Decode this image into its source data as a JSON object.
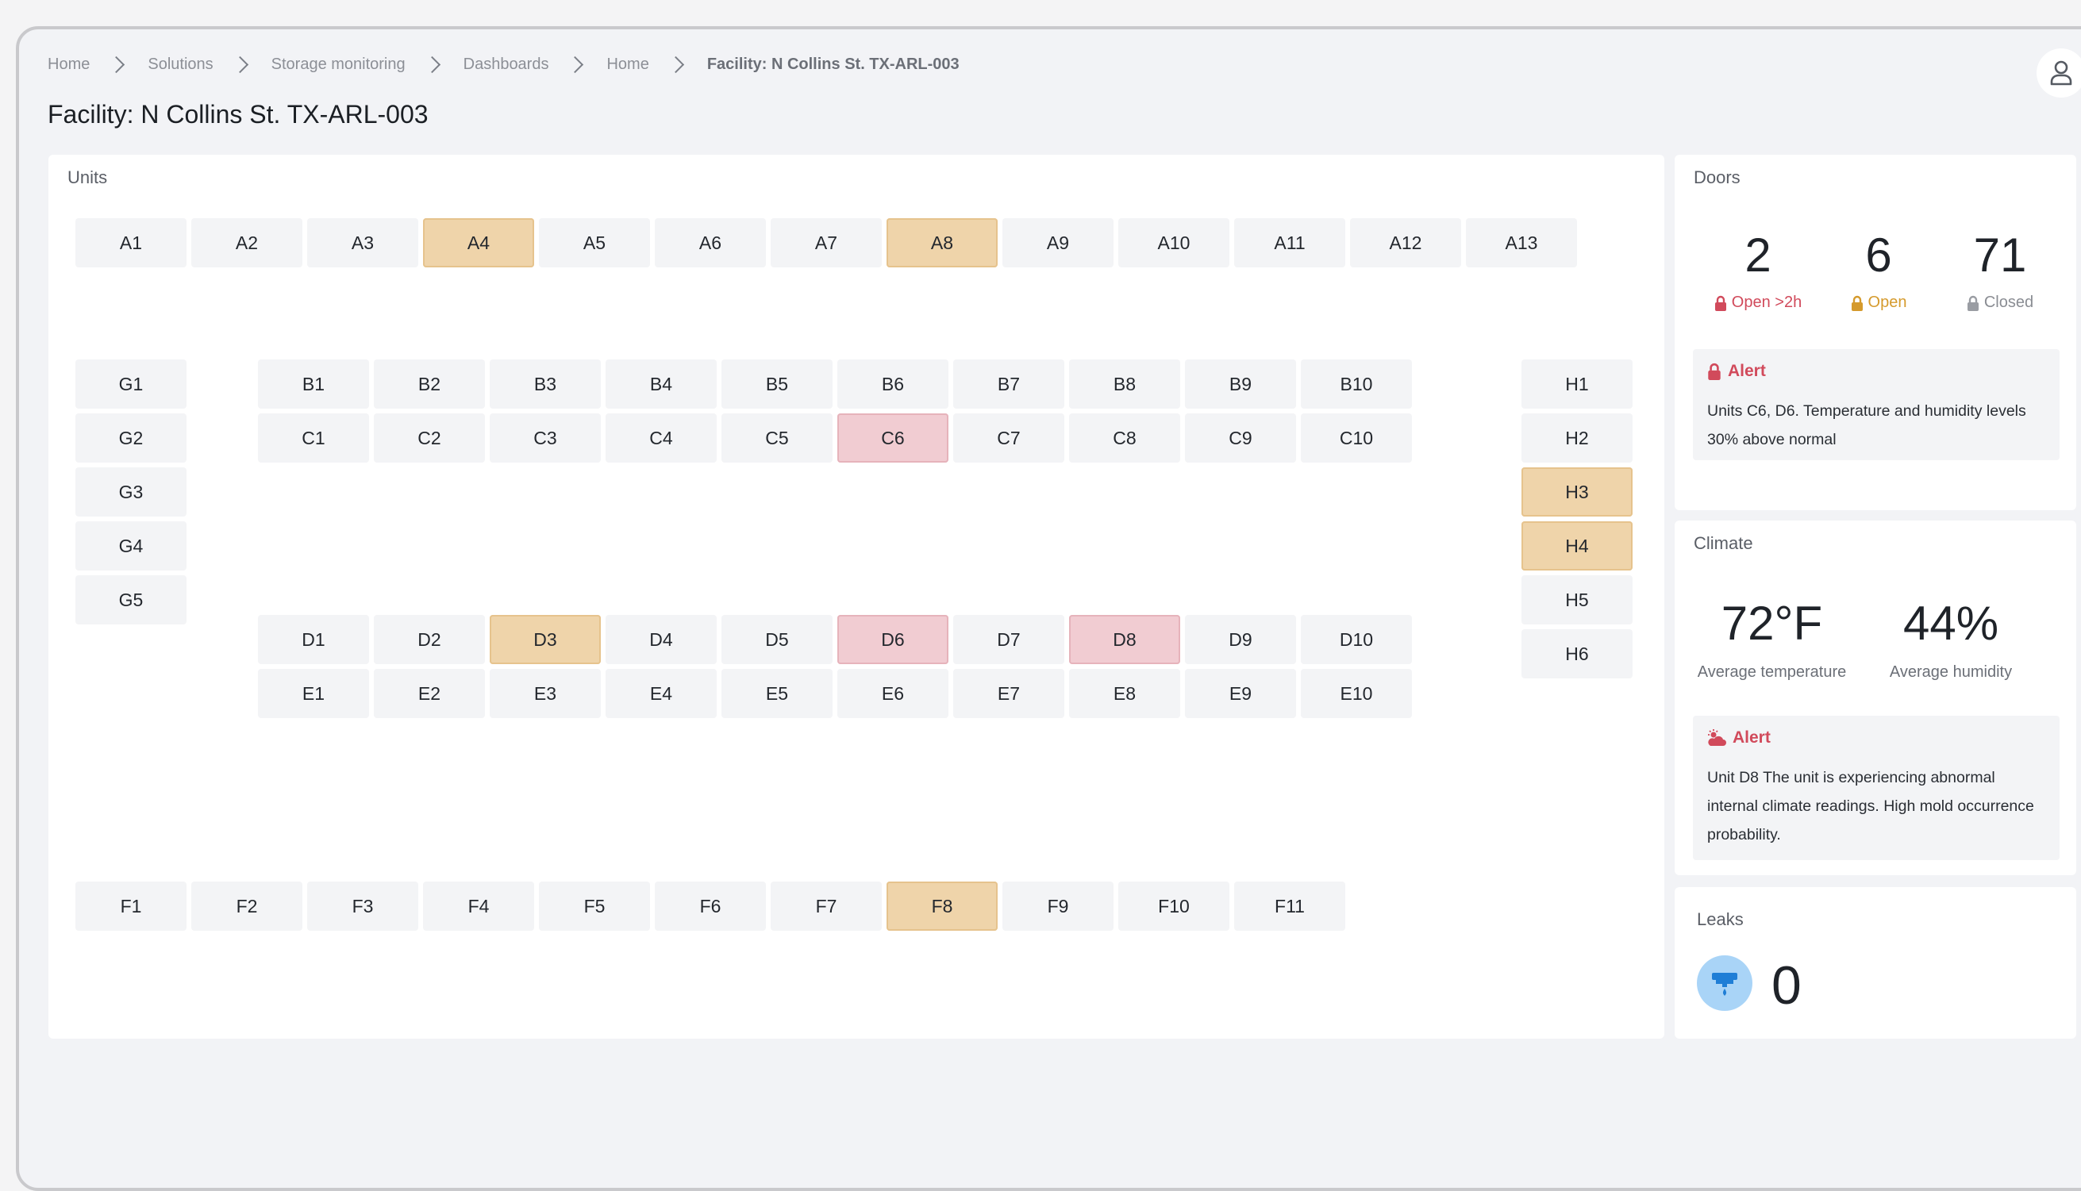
{
  "breadcrumb": [
    "Home",
    "Solutions",
    "Storage monitoring",
    "Dashboards",
    "Home",
    "Facility: N Collins St. TX-ARL-003"
  ],
  "page_title": "Facility: N Collins St. TX-ARL-003",
  "units_panel": {
    "title": "Units",
    "status_colors": {
      "normal": "#f3f4f6",
      "warning": "#efd4aa",
      "danger": "#f1ccd2"
    },
    "rows": [
      {
        "row": "A",
        "units": [
          {
            "id": "A1",
            "status": "normal"
          },
          {
            "id": "A2",
            "status": "normal"
          },
          {
            "id": "A3",
            "status": "normal"
          },
          {
            "id": "A4",
            "status": "warning"
          },
          {
            "id": "A5",
            "status": "normal"
          },
          {
            "id": "A6",
            "status": "normal"
          },
          {
            "id": "A7",
            "status": "normal"
          },
          {
            "id": "A8",
            "status": "warning"
          },
          {
            "id": "A9",
            "status": "normal"
          },
          {
            "id": "A10",
            "status": "normal"
          },
          {
            "id": "A11",
            "status": "normal"
          },
          {
            "id": "A12",
            "status": "normal"
          },
          {
            "id": "A13",
            "status": "normal"
          }
        ]
      },
      {
        "row": "G",
        "units": [
          {
            "id": "G1",
            "status": "normal"
          },
          {
            "id": "G2",
            "status": "normal"
          },
          {
            "id": "G3",
            "status": "normal"
          },
          {
            "id": "G4",
            "status": "normal"
          },
          {
            "id": "G5",
            "status": "normal"
          }
        ]
      },
      {
        "row": "B",
        "units": [
          {
            "id": "B1",
            "status": "normal"
          },
          {
            "id": "B2",
            "status": "normal"
          },
          {
            "id": "B3",
            "status": "normal"
          },
          {
            "id": "B4",
            "status": "normal"
          },
          {
            "id": "B5",
            "status": "normal"
          },
          {
            "id": "B6",
            "status": "normal"
          },
          {
            "id": "B7",
            "status": "normal"
          },
          {
            "id": "B8",
            "status": "normal"
          },
          {
            "id": "B9",
            "status": "normal"
          },
          {
            "id": "B10",
            "status": "normal"
          }
        ]
      },
      {
        "row": "C",
        "units": [
          {
            "id": "C1",
            "status": "normal"
          },
          {
            "id": "C2",
            "status": "normal"
          },
          {
            "id": "C3",
            "status": "normal"
          },
          {
            "id": "C4",
            "status": "normal"
          },
          {
            "id": "C5",
            "status": "normal"
          },
          {
            "id": "C6",
            "status": "danger"
          },
          {
            "id": "C7",
            "status": "normal"
          },
          {
            "id": "C8",
            "status": "normal"
          },
          {
            "id": "C9",
            "status": "normal"
          },
          {
            "id": "C10",
            "status": "normal"
          }
        ]
      },
      {
        "row": "H",
        "units": [
          {
            "id": "H1",
            "status": "normal"
          },
          {
            "id": "H2",
            "status": "normal"
          },
          {
            "id": "H3",
            "status": "warning"
          },
          {
            "id": "H4",
            "status": "warning"
          },
          {
            "id": "H5",
            "status": "normal"
          },
          {
            "id": "H6",
            "status": "normal"
          }
        ]
      },
      {
        "row": "D",
        "units": [
          {
            "id": "D1",
            "status": "normal"
          },
          {
            "id": "D2",
            "status": "normal"
          },
          {
            "id": "D3",
            "status": "warning"
          },
          {
            "id": "D4",
            "status": "normal"
          },
          {
            "id": "D5",
            "status": "normal"
          },
          {
            "id": "D6",
            "status": "danger"
          },
          {
            "id": "D7",
            "status": "normal"
          },
          {
            "id": "D8",
            "status": "danger"
          },
          {
            "id": "D9",
            "status": "normal"
          },
          {
            "id": "D10",
            "status": "normal"
          }
        ]
      },
      {
        "row": "E",
        "units": [
          {
            "id": "E1",
            "status": "normal"
          },
          {
            "id": "E2",
            "status": "normal"
          },
          {
            "id": "E3",
            "status": "normal"
          },
          {
            "id": "E4",
            "status": "normal"
          },
          {
            "id": "E5",
            "status": "normal"
          },
          {
            "id": "E6",
            "status": "normal"
          },
          {
            "id": "E7",
            "status": "normal"
          },
          {
            "id": "E8",
            "status": "normal"
          },
          {
            "id": "E9",
            "status": "normal"
          },
          {
            "id": "E10",
            "status": "normal"
          }
        ]
      },
      {
        "row": "F",
        "units": [
          {
            "id": "F1",
            "status": "normal"
          },
          {
            "id": "F2",
            "status": "normal"
          },
          {
            "id": "F3",
            "status": "normal"
          },
          {
            "id": "F4",
            "status": "normal"
          },
          {
            "id": "F5",
            "status": "normal"
          },
          {
            "id": "F6",
            "status": "normal"
          },
          {
            "id": "F7",
            "status": "normal"
          },
          {
            "id": "F8",
            "status": "warning"
          },
          {
            "id": "F9",
            "status": "normal"
          },
          {
            "id": "F10",
            "status": "normal"
          },
          {
            "id": "F11",
            "status": "normal"
          }
        ]
      }
    ]
  },
  "doors": {
    "title": "Doors",
    "stats": [
      {
        "value": "2",
        "label": "Open >2h",
        "icon": "lock-open-icon",
        "color": "#d14a5b"
      },
      {
        "value": "6",
        "label": "Open",
        "icon": "lock-open-icon",
        "color": "#d59a2c"
      },
      {
        "value": "71",
        "label": "Closed",
        "icon": "lock-closed-icon",
        "color": "#8a8d93"
      }
    ],
    "alert": {
      "title": "Alert",
      "icon": "lock-open-icon",
      "text": "Units C6, D6. Temperature and humidity levels 30% above normal"
    }
  },
  "climate": {
    "title": "Climate",
    "temperature": {
      "value": "72°F",
      "label": "Average temperature"
    },
    "humidity": {
      "value": "44%",
      "label": "Average humidity"
    },
    "alert": {
      "title": "Alert",
      "icon": "weather-alert-icon",
      "text": "Unit D8 The unit is experiencing abnormal internal climate readings. High mold occurrence probability."
    }
  },
  "leaks": {
    "title": "Leaks",
    "icon": "water-leak-icon",
    "count": "0"
  }
}
